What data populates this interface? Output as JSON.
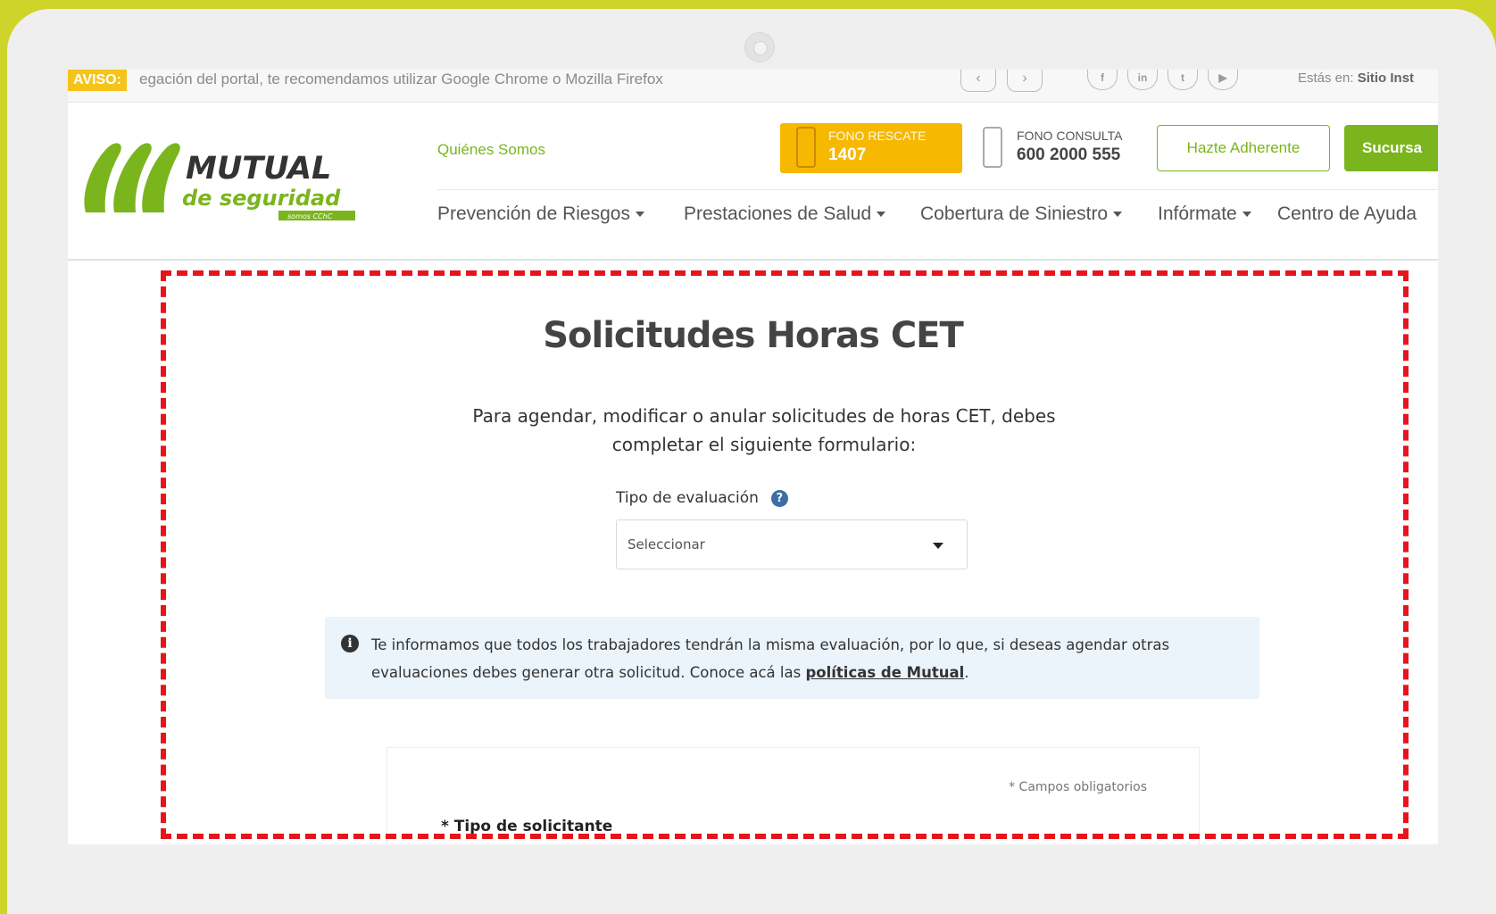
{
  "topbar": {
    "aviso_label": "AVISO:",
    "aviso_text": "egación del portal, te recomendamos utilizar Google Chrome o Mozilla Firefox",
    "prev_glyph": "‹",
    "next_glyph": "›",
    "social": [
      "f",
      "in",
      "t",
      "▶"
    ],
    "estas_en_label": "Estás en:",
    "estas_en_value": "Sitio Inst"
  },
  "header": {
    "logo_title": "MUTUAL",
    "logo_subtitle": "de seguridad",
    "logo_tag": "somos CChC",
    "quienes_somos": "Quiénes Somos",
    "fono_rescate_label": "FONO RESCATE",
    "fono_rescate_number": "1407",
    "fono_consulta_label": "FONO CONSULTA",
    "fono_consulta_number": "600 2000 555",
    "hazte_button": "Hazte Adherente",
    "sucursal_button": "Sucursa"
  },
  "nav": {
    "items": [
      {
        "label": "Prevención de Riesgos"
      },
      {
        "label": "Prestaciones de Salud"
      },
      {
        "label": "Cobertura de Siniestro"
      },
      {
        "label": "Infórmate"
      },
      {
        "label": "Centro de Ayuda"
      }
    ]
  },
  "content": {
    "title": "Solicitudes Horas CET",
    "description": "Para agendar, modificar o anular solicitudes de horas CET, debes completar el siguiente formulario:",
    "tipo_label": "Tipo de evaluación",
    "select_value": "Seleccionar",
    "info_text": "Te informamos que todos los trabajadores tendrán la misma evaluación, por lo que, si deseas agendar otras evaluaciones debes generar otra solicitud. Conoce acá las ",
    "info_link": "políticas de Mutual",
    "info_end": ".",
    "campos_obligatorios": "* Campos obligatorios",
    "tipo_solicitante": "* Tipo de solicitante"
  },
  "colors": {
    "brand_green": "#7ab51d",
    "rescate_yellow": "#f6b800",
    "highlight_red": "#e8141b",
    "background": "#cfd42a"
  }
}
